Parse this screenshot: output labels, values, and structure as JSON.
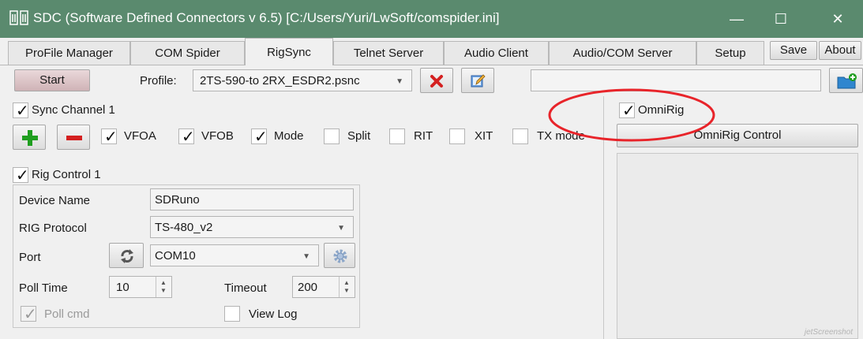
{
  "window": {
    "title": "SDC (Software Defined Connectors v 6.5) [C:/Users/Yuri/LwSoft/comspider.ini]",
    "minimize": "—",
    "maximize": "☐",
    "close": "✕"
  },
  "tabs": [
    {
      "label": "ProFile Manager"
    },
    {
      "label": "COM Spider"
    },
    {
      "label": "RigSync"
    },
    {
      "label": "Telnet Server"
    },
    {
      "label": "Audio Client"
    },
    {
      "label": "Audio/COM Server"
    },
    {
      "label": "Setup"
    }
  ],
  "header_buttons": {
    "save": "Save",
    "about": "About"
  },
  "toolbar": {
    "start": "Start",
    "profile_label": "Profile:",
    "profile_value": "2TS-590-to 2RX_ESDR2.psnc",
    "status_value": ""
  },
  "sync": {
    "channel_label": "Sync Channel 1",
    "channel_checked": true,
    "options": [
      {
        "label": "VFOA",
        "checked": true
      },
      {
        "label": "VFOB",
        "checked": true
      },
      {
        "label": "Mode",
        "checked": true
      },
      {
        "label": "Split",
        "checked": false
      },
      {
        "label": "RIT",
        "checked": false
      },
      {
        "label": "XIT",
        "checked": false
      },
      {
        "label": "TX mode",
        "checked": false
      }
    ]
  },
  "omnirig": {
    "label": "OmniRig",
    "checked": true,
    "control_button": "OmniRig Control"
  },
  "rig_control": {
    "title": "Rig Control 1",
    "checked": true,
    "device_name_label": "Device Name",
    "device_name_value": "SDRuno",
    "protocol_label": "RIG Protocol",
    "protocol_value": "TS-480_v2",
    "port_label": "Port",
    "port_value": "COM10",
    "poll_time_label": "Poll Time",
    "poll_time_value": "10",
    "timeout_label": "Timeout",
    "timeout_value": "200",
    "poll_cmd_label": "Poll cmd",
    "poll_cmd_checked": true,
    "view_log_label": "View Log",
    "view_log_checked": false
  },
  "watermark": "jetScreenshot",
  "colors": {
    "titlebar": "#5a8a6e",
    "annotation": "#e8242a",
    "add_green": "#1f9e1f",
    "remove_red": "#d42020"
  },
  "icons": [
    "app-icon",
    "delete-icon",
    "edit-icon",
    "folder-add-icon",
    "add-icon",
    "remove-icon",
    "refresh-icon",
    "settings-icon"
  ]
}
